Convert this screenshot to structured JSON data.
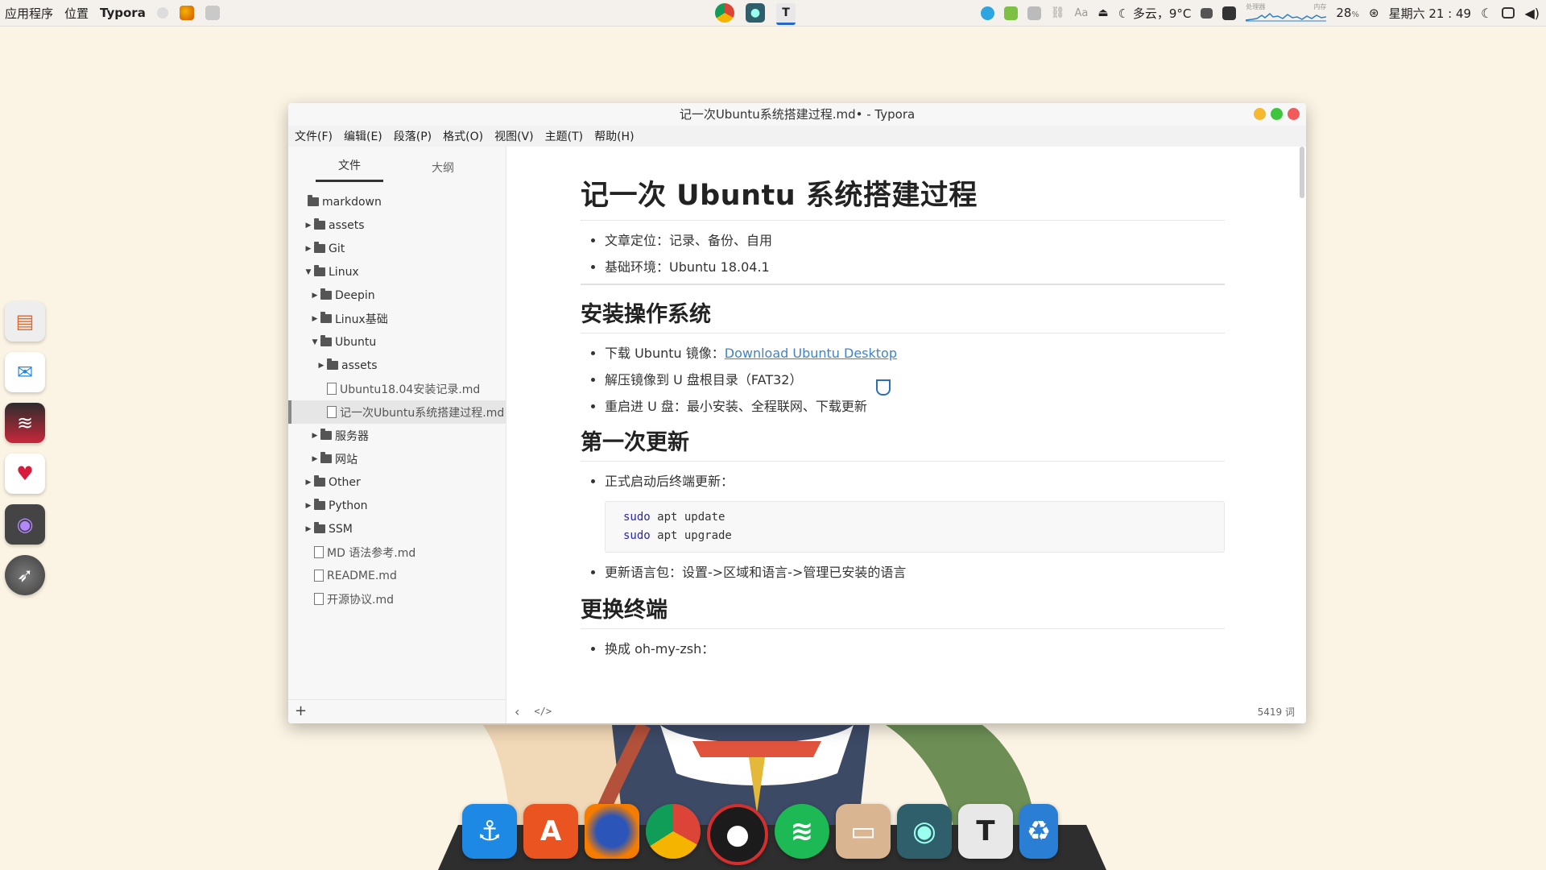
{
  "topbar": {
    "menu_apps": "应用程序",
    "menu_places": "位置",
    "active_app": "Typora",
    "weather": "多云，9°C",
    "cpu_label": "处理器",
    "mem_label": "内存",
    "cpu_percent": "28",
    "cpu_unit": "%",
    "datetime": "星期六 21 : 49"
  },
  "window": {
    "title": "记一次Ubuntu系统搭建过程.md• - Typora",
    "menus": [
      "文件(F)",
      "编辑(E)",
      "段落(P)",
      "格式(O)",
      "视图(V)",
      "主题(T)",
      "帮助(H)"
    ]
  },
  "sidebar": {
    "tab_files": "文件",
    "tab_outline": "大纲",
    "tree": [
      {
        "label": "markdown",
        "type": "folder",
        "depth": 0,
        "state": "none"
      },
      {
        "label": "assets",
        "type": "folder",
        "depth": 1,
        "state": "collapsed"
      },
      {
        "label": "Git",
        "type": "folder",
        "depth": 1,
        "state": "collapsed"
      },
      {
        "label": "Linux",
        "type": "folder",
        "depth": 1,
        "state": "expanded"
      },
      {
        "label": "Deepin",
        "type": "folder",
        "depth": 2,
        "state": "collapsed"
      },
      {
        "label": "Linux基础",
        "type": "folder",
        "depth": 2,
        "state": "collapsed"
      },
      {
        "label": "Ubuntu",
        "type": "folder",
        "depth": 2,
        "state": "expanded"
      },
      {
        "label": "assets",
        "type": "folder",
        "depth": 3,
        "state": "collapsed"
      },
      {
        "label": "Ubuntu18.04安装记录.md",
        "type": "file",
        "depth": 3,
        "state": "none"
      },
      {
        "label": "记一次Ubuntu系统搭建过程.md",
        "type": "file",
        "depth": 3,
        "state": "active"
      },
      {
        "label": "服务器",
        "type": "folder",
        "depth": 2,
        "state": "collapsed"
      },
      {
        "label": "网站",
        "type": "folder",
        "depth": 2,
        "state": "collapsed"
      },
      {
        "label": "Other",
        "type": "folder",
        "depth": 1,
        "state": "collapsed"
      },
      {
        "label": "Python",
        "type": "folder",
        "depth": 1,
        "state": "collapsed"
      },
      {
        "label": "SSM",
        "type": "folder",
        "depth": 1,
        "state": "collapsed"
      },
      {
        "label": "MD 语法参考.md",
        "type": "file",
        "depth": 1,
        "state": "none"
      },
      {
        "label": "README.md",
        "type": "file",
        "depth": 1,
        "state": "none"
      },
      {
        "label": "开源协议.md",
        "type": "file",
        "depth": 1,
        "state": "none"
      }
    ],
    "add_label": "+"
  },
  "doc": {
    "h1": "记一次 Ubuntu 系统搭建过程",
    "intro": [
      "文章定位：记录、备份、自用",
      "基础环境：Ubuntu 18.04.1"
    ],
    "s1_title": "安装操作系统",
    "s1_item1_prefix": "下载 Ubuntu 镜像：",
    "s1_item1_link": "Download Ubuntu Desktop",
    "s1_item2": "解压镜像到 U 盘根目录（FAT32）",
    "s1_item3": "重启进 U 盘：最小安装、全程联网、下载更新",
    "s2_title": "第一次更新",
    "s2_item1": "正式启动后终端更新：",
    "code_line1_kw": "sudo",
    "code_line1_rest": " apt update",
    "code_line2_kw": "sudo",
    "code_line2_rest": " apt upgrade",
    "s2_item2": "更新语言包：设置->区域和语言->管理已安装的语言",
    "s3_title": "更换终端",
    "s3_item1": "换成 oh-my-zsh："
  },
  "status": {
    "back": "‹",
    "source": "</>",
    "word_count": "5419 词"
  },
  "colors": {
    "link": "#4183c4",
    "close": "#f25b5b",
    "maximize": "#3ec43e",
    "minimize": "#f5b82e"
  }
}
